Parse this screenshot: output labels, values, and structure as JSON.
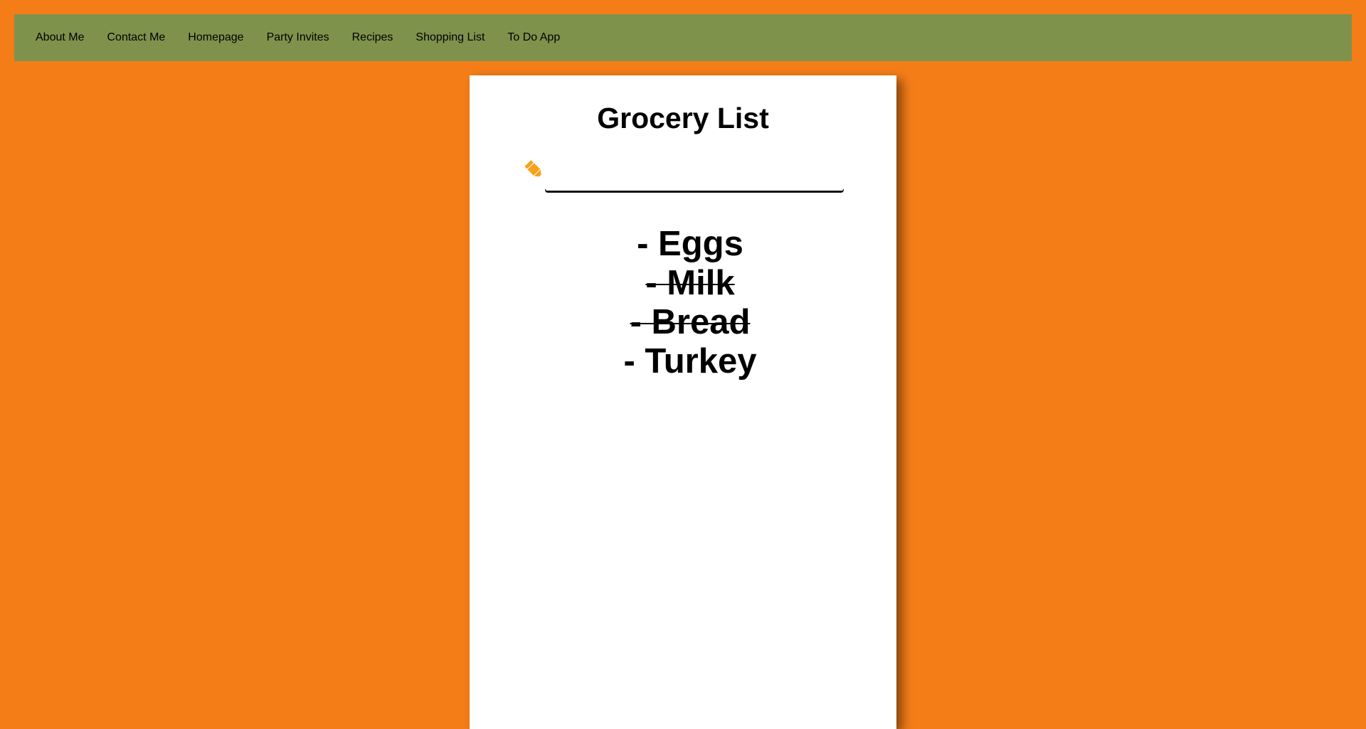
{
  "nav": {
    "links": [
      "About Me",
      "Contact Me",
      "Homepage",
      "Party Invites",
      "Recipes",
      "Shopping List",
      "To Do App"
    ]
  },
  "card": {
    "title": "Grocery List",
    "input": {
      "value": "",
      "placeholder": "",
      "icon": "pencil-icon",
      "icon_color": "#f8a11a"
    },
    "items": [
      {
        "label": "- Eggs",
        "done": false
      },
      {
        "label": "- Milk",
        "done": true
      },
      {
        "label": "- Bread",
        "done": true
      },
      {
        "label": "- Turkey",
        "done": false
      }
    ]
  },
  "colors": {
    "background": "#f47d18",
    "navbar": "#7f924c",
    "card": "#ffffff",
    "text": "#000000"
  }
}
